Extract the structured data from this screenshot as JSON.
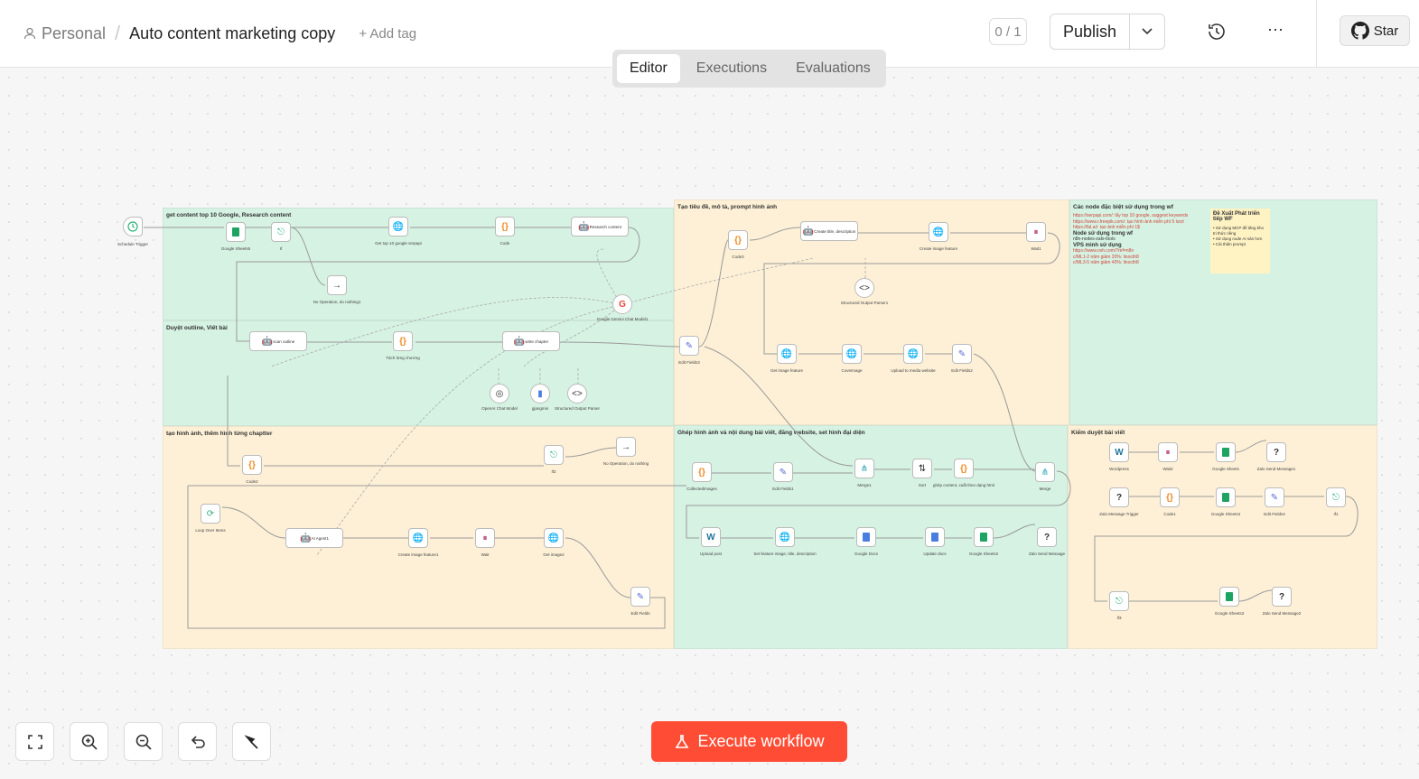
{
  "header": {
    "workspace": "Personal",
    "separator": "/",
    "workflow_name": "Auto content marketing copy",
    "add_tag": "+ Add tag",
    "version_counter": "0 / 1",
    "publish_label": "Publish",
    "star_label": "Star"
  },
  "tabs": [
    "Editor",
    "Executions",
    "Evaluations"
  ],
  "active_tab": "Editor",
  "zones": {
    "z1": "get content top 10 Google, Research content",
    "z2": "Duyệt outline, Viết bài",
    "z3": "Tạo tiêu đề, mô tả, prompt hình ảnh",
    "z4": "Các node đặc biệt sử dụng trong wf",
    "z5": "tạo hình ảnh, thêm hình từng chaptter",
    "z6": "Ghép hình ảnh và nội dung bài viết, đăng website, set hình đại diện",
    "z7": "Kiểm duyệt bài viết"
  },
  "nodes": {
    "n1": "Schedule Trigger",
    "n2": "Google Sheets5",
    "n3": "If",
    "n4": "Get top 10 google serpapi",
    "n5": "Code",
    "n6": "Research content",
    "n7": "No Operation, do nothing1",
    "n8": "Google Gemini Chat Model1",
    "n9": "scan outline",
    "n10": "Tách từng chương",
    "n11": "write chapter",
    "n12": "OpenAI Chat Model",
    "n13": "gjangmin",
    "n14": "Structured Output Parser",
    "n15": "Code3",
    "n16": "Create title, description",
    "n17": "Create image feature",
    "n18": "Wait1",
    "n19": "Structured Output Parser1",
    "n20": "Edit Fields3",
    "n21": "Get image feature",
    "n22": "CoveImage",
    "n23": "Upload to media website",
    "n24": "Edit Fields2",
    "n25": "Code2",
    "n26": "If2",
    "n27": "No Operation, do nothing",
    "n28": "Loop Over Items",
    "n29": "AI Agent1",
    "n30": "Create image feature1",
    "n31": "Wait",
    "n32": "Get image2",
    "n33": "Edit Fields",
    "n34": "CollectedImages",
    "n35": "Edit Fields1",
    "n36": "Merge1",
    "n37": "Sort",
    "n38": "ghép content, xuất theo dạng html",
    "n39": "Merge",
    "n40": "Upload post",
    "n41": "Set feature image, title, description",
    "n42": "Google Docs",
    "n43": "Update docs",
    "n44": "Google Sheets2",
    "n45": "Zalo Send Message",
    "n46": "Wordpress",
    "n47": "Wait2",
    "n48": "Google Sheets",
    "n49": "Zalo Send Message1",
    "n50": "Zalo Message Trigger",
    "n51": "Code1",
    "n52": "Google Sheets4",
    "n53": "Edit Fields4",
    "n54": "If1",
    "n55": "If3",
    "n56": "Google Sheets3",
    "n57": "Zalo Send Message2"
  },
  "special_note": {
    "l1": "https://serpapi.com/: lấy top 10 google, suggest keywords",
    "l2": "https://www.r.freepik.com/: tạo hình ảnh miễn phí 5 lượt",
    "l3": "https://fal.ai/: tạo ảnh miễn phí 1$",
    "h2": "Node sử dụng trong wf",
    "l4": "n8n-nodes-zalo-tools",
    "h3": "VPS mình sử dụng",
    "l5": "https://www.ovh.com/?ref=n8n",
    "l6": "c/ML1-2 năm giảm 20%: linocth8",
    "l7": "c/ML3-5 năm giảm 40%: linocth8"
  },
  "sticky": {
    "title": "Đề Xuất Phát triển tiếp WF",
    "i1": "• Sử dụng MCP để tăng kho tri thức riêng",
    "i2": "• Sử dụng node AI sản hơn",
    "i3": "• Cải thiện prompt"
  },
  "execute_label": "Execute workflow"
}
